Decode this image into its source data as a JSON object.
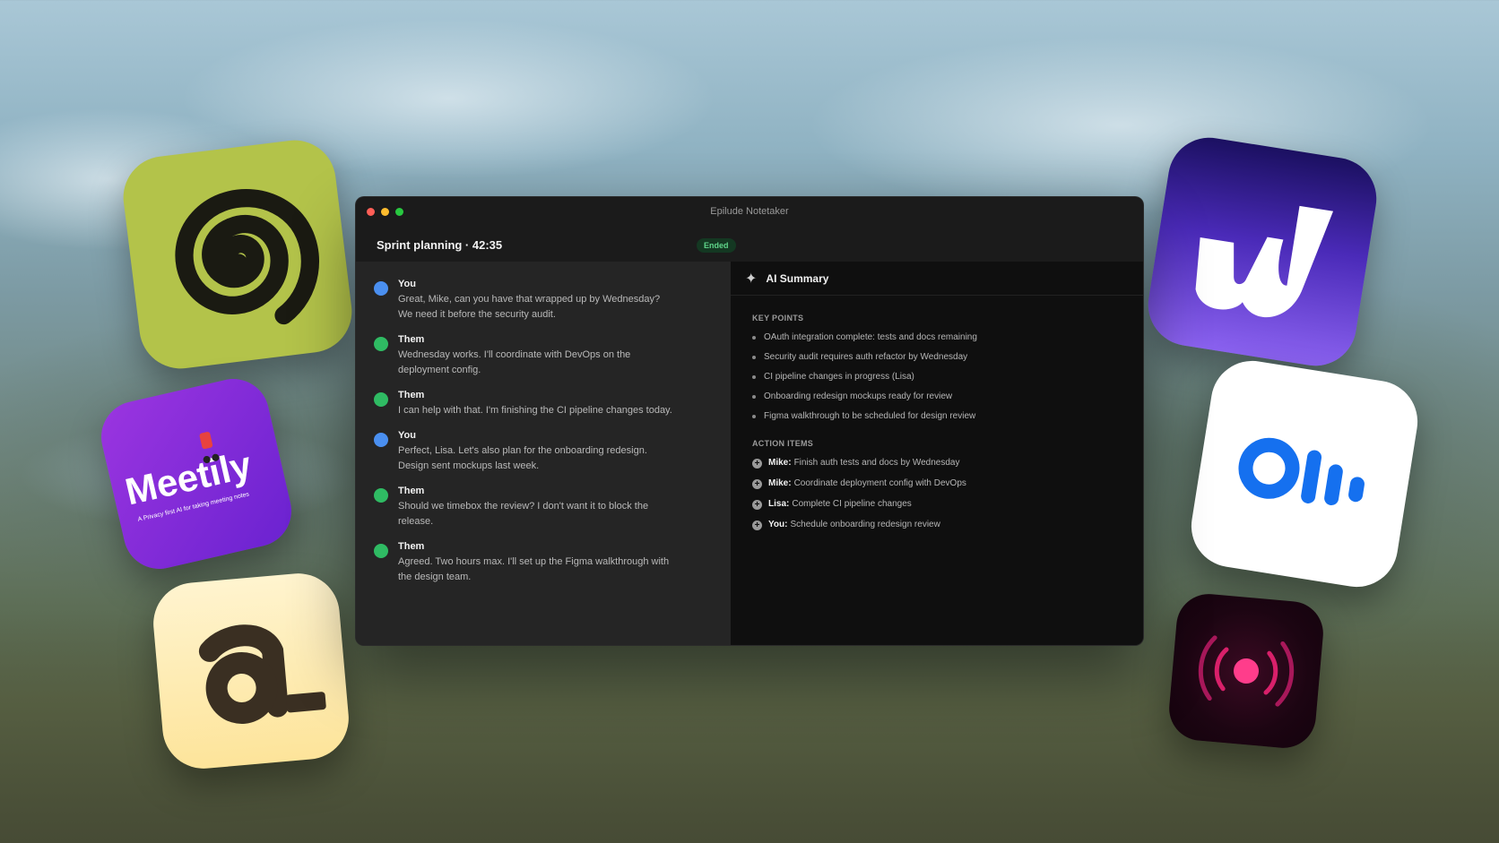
{
  "window": {
    "title": "Epilude Notetaker",
    "meeting_title": "Sprint planning · 42:35",
    "status_badge": "Ended"
  },
  "transcript": [
    {
      "speaker": "You",
      "text": "Great, Mike, can you have that wrapped up by Wednesday? We need it before the security audit.",
      "color": "#4a8ff0"
    },
    {
      "speaker": "Them",
      "text": "Wednesday works. I'll coordinate with DevOps on the deployment config.",
      "color": "#2fbb63"
    },
    {
      "speaker": "Them",
      "text": "I can help with that. I'm finishing the CI pipeline changes today.",
      "color": "#2fbb63"
    },
    {
      "speaker": "You",
      "text": "Perfect, Lisa. Let's also plan for the onboarding redesign. Design sent mockups last week.",
      "color": "#4a8ff0"
    },
    {
      "speaker": "Them",
      "text": "Should we timebox the review? I don't want it to block the release.",
      "color": "#2fbb63"
    },
    {
      "speaker": "Them",
      "text": "Agreed. Two hours max. I'll set up the Figma walkthrough with the design team.",
      "color": "#2fbb63"
    }
  ],
  "summary": {
    "title": "AI Summary",
    "icon": "sparkle-icon",
    "key_points_label": "KEY POINTS",
    "key_points": [
      "OAuth integration complete: tests and docs remaining",
      "Security audit requires auth refactor by Wednesday",
      "CI pipeline changes in progress (Lisa)",
      "Onboarding redesign mockups ready for review",
      "Figma walkthrough to be scheduled for design review"
    ],
    "action_items_label": "ACTION ITEMS",
    "action_items": [
      {
        "owner": "Mike:",
        "task": "Finish auth tests and docs by Wednesday"
      },
      {
        "owner": "Mike:",
        "task": "Coordinate deployment config with DevOps"
      },
      {
        "owner": "Lisa:",
        "task": "Complete CI pipeline changes"
      },
      {
        "owner": "You:",
        "task": "Schedule onboarding redesign review"
      }
    ]
  },
  "app_icons": {
    "meetily_label": "Meetily",
    "meetily_tagline": "A Privacy first AI for taking meeting notes",
    "icons": [
      "spiral-app-icon",
      "meetily-app-icon",
      "a-app-icon",
      "j-app-icon",
      "otter-app-icon",
      "recorder-app-icon"
    ]
  },
  "colors": {
    "you_avatar": "#4a8ff0",
    "them_avatar": "#2fbb63",
    "badge_text": "#5fd489"
  }
}
